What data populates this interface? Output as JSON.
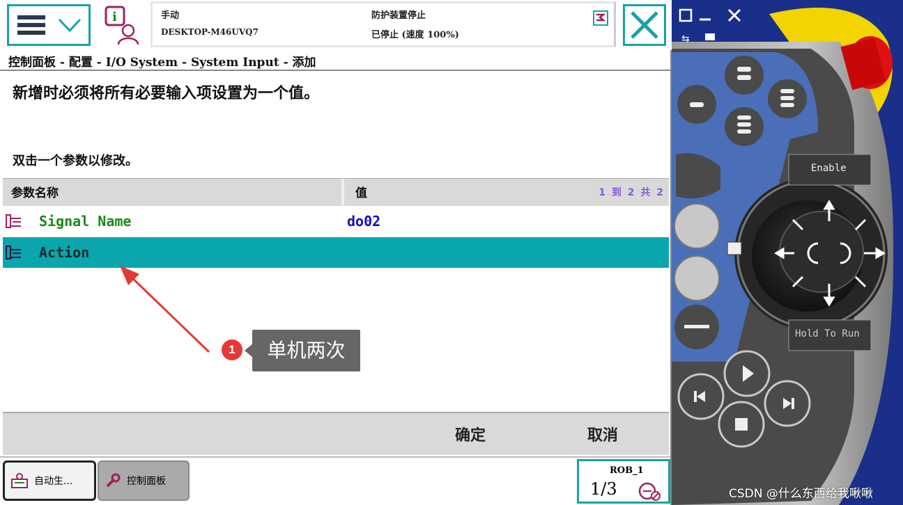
{
  "header": {
    "mode": "手动",
    "host": "DESKTOP-M46UVQ7",
    "safety_status": "防护装置停止",
    "run_status": "已停止 (速度 100%)"
  },
  "breadcrumb": "控制面板 - 配置 - I/O System - System Input - 添加",
  "instructions": {
    "line1": "新增时必须将所有必要输入项设置为一个值。",
    "line2": "双击一个参数以修改。"
  },
  "table": {
    "columns": [
      "参数名称",
      "值"
    ],
    "pager": "1 到 2 共 2",
    "rows": [
      {
        "name": "Signal Name",
        "value": "do02"
      },
      {
        "name": "Action",
        "value": ""
      }
    ]
  },
  "callout": {
    "number": "1",
    "text": "单机两次"
  },
  "actions": {
    "ok": "确定",
    "cancel": "取消"
  },
  "taskbar": {
    "items": [
      "自动生...",
      "控制面板"
    ],
    "robot": "ROB_1",
    "fraction": "1/3"
  },
  "device": {
    "enable_label": "Enable",
    "hold_label": "Hold To Run"
  },
  "watermark": "CSDN @什么东西给我啾啾",
  "colors": {
    "accent": "#17a2a8",
    "selected_row": "#0aa5ad",
    "device_bg": "#1a2f8a",
    "estop": "#e01010"
  }
}
